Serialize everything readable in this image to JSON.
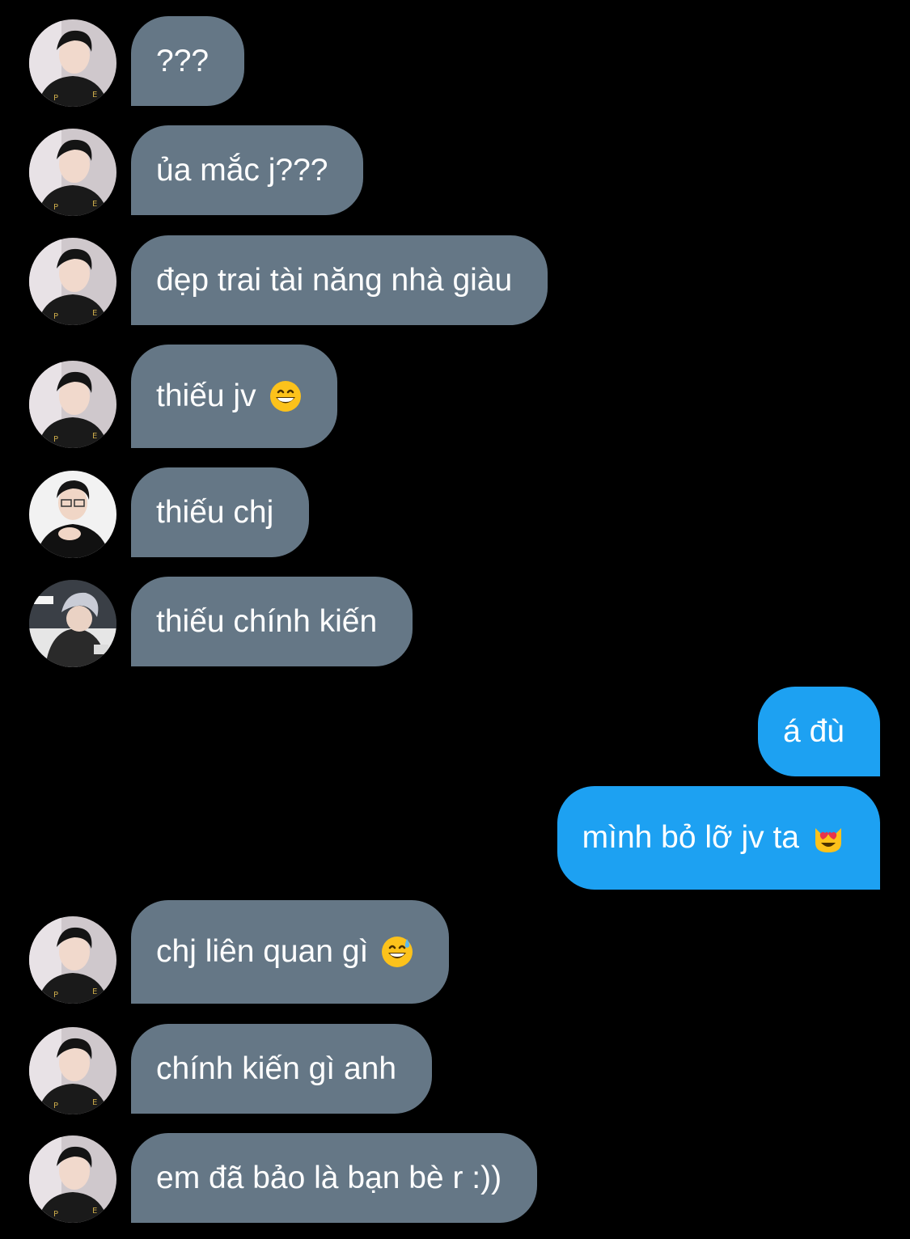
{
  "conversation": {
    "messages": [
      {
        "sender": "other",
        "avatar": "avatar-a",
        "text": "???",
        "emoji": ""
      },
      {
        "sender": "other",
        "avatar": "avatar-a",
        "text": "ủa mắc j???",
        "emoji": ""
      },
      {
        "sender": "other",
        "avatar": "avatar-a",
        "text": "đẹp trai tài năng nhà giàu",
        "emoji": ""
      },
      {
        "sender": "other",
        "avatar": "avatar-a",
        "text": "thiếu jv",
        "emoji": "grinning-face-emoji"
      },
      {
        "sender": "other",
        "avatar": "avatar-b",
        "text": "thiếu chj",
        "emoji": ""
      },
      {
        "sender": "other",
        "avatar": "avatar-c",
        "text": "thiếu chính kiến",
        "emoji": ""
      },
      {
        "sender": "me",
        "text": "á đù",
        "emoji": ""
      },
      {
        "sender": "me",
        "text": "mình bỏ lỡ jv ta",
        "emoji": "heart-eyes-cat-emoji"
      },
      {
        "sender": "other",
        "avatar": "avatar-a",
        "text": "chj liên quan gì",
        "emoji": "sweat-smile-emoji"
      },
      {
        "sender": "other",
        "avatar": "avatar-a",
        "text": "chính kiến gì anh",
        "emoji": ""
      },
      {
        "sender": "other",
        "avatar": "avatar-a",
        "text": "em đã bảo là bạn bè r :))",
        "emoji": ""
      }
    ]
  },
  "colors": {
    "background": "#000000",
    "received_bubble": "#657786",
    "sent_bubble": "#1da1f2",
    "text": "#ffffff"
  }
}
